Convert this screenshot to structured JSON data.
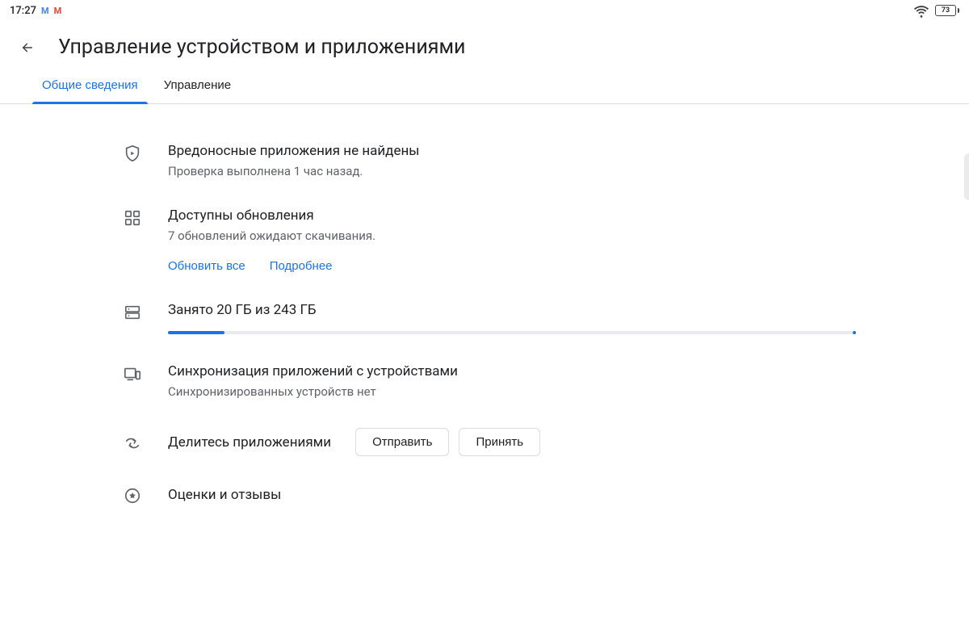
{
  "statusbar": {
    "time": "17:27",
    "battery_percent": "73"
  },
  "header": {
    "title": "Управление устройством и приложениями"
  },
  "tabs": {
    "overview": "Общие сведения",
    "manage": "Управление"
  },
  "protect": {
    "title": "Вредоносные приложения не найдены",
    "subtitle": "Проверка выполнена 1 час назад."
  },
  "updates": {
    "title": "Доступны обновления",
    "subtitle": "7 обновлений ожидают скачивания.",
    "update_all": "Обновить все",
    "details": "Подробнее"
  },
  "storage": {
    "title": "Занято 20 ГБ из 243 ГБ",
    "used_gb": 20,
    "total_gb": 243,
    "fill_percent": 8.2
  },
  "sync": {
    "title": "Синхронизация приложений с устройствами",
    "subtitle": "Синхронизированных устройств нет"
  },
  "share": {
    "title": "Делитесь приложениями",
    "send": "Отправить",
    "receive": "Принять"
  },
  "ratings": {
    "title": "Оценки и отзывы"
  }
}
